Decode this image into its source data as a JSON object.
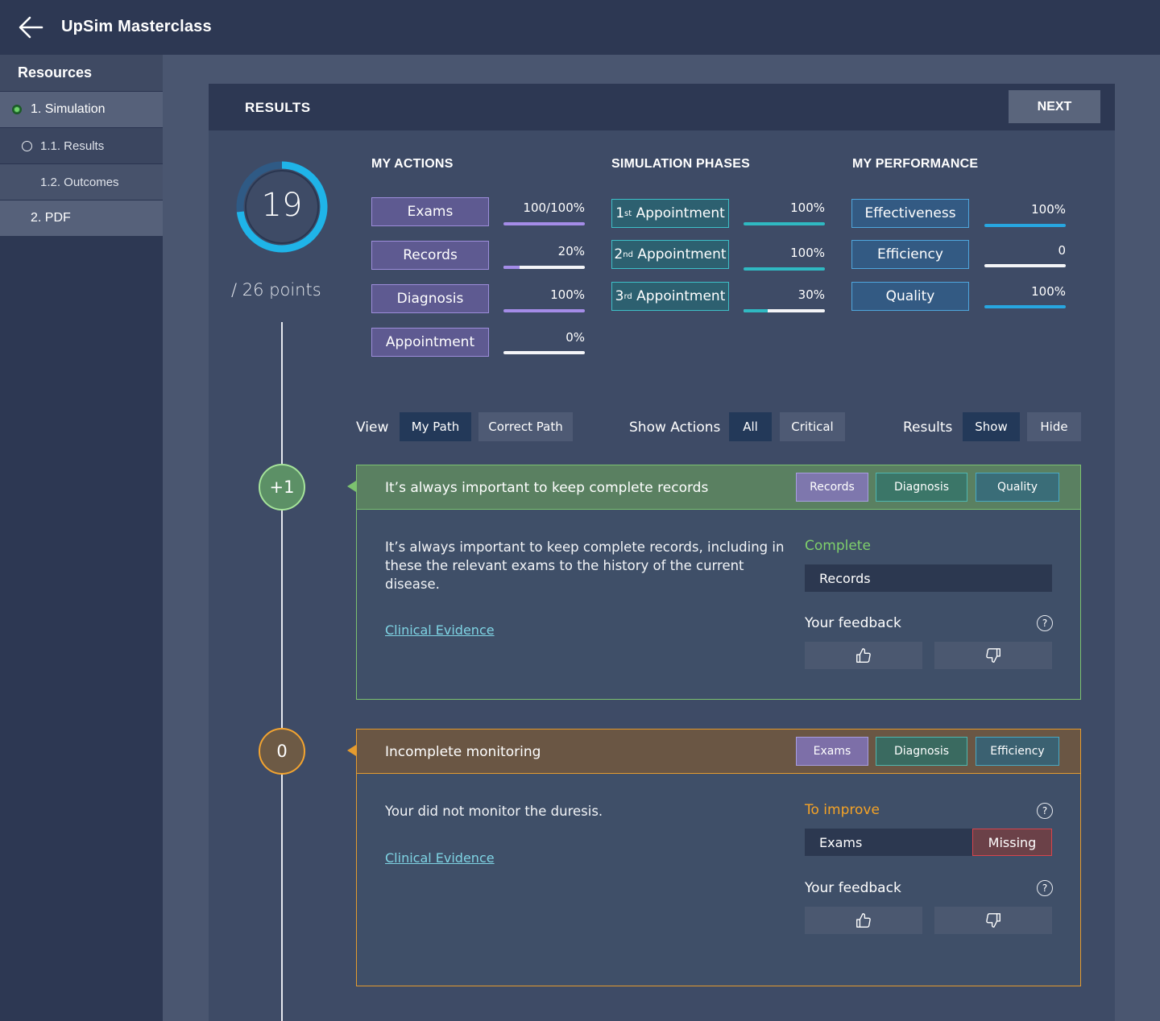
{
  "app": {
    "title": "UpSim Masterclass",
    "back_icon": "arrow-left-icon"
  },
  "sidebar": {
    "heading": "Resources",
    "items": [
      {
        "label": "1. Simulation",
        "state": "active"
      },
      {
        "label": "1.1. Results",
        "state": "current"
      },
      {
        "label": "1.2. Outcomes",
        "state": "default"
      },
      {
        "label": "2. PDF",
        "state": "default"
      }
    ]
  },
  "panel": {
    "title": "RESULTS",
    "next_label": "NEXT"
  },
  "score": {
    "value": "19",
    "total_label": "/ 26 points",
    "value_num": 19,
    "max": 26,
    "ring_color": "#1fb4e8"
  },
  "columns": {
    "actions_title": "MY ACTIONS",
    "phases_title": "SIMULATION PHASES",
    "performance_title": "MY PERFORMANCE"
  },
  "actions": [
    {
      "label": "Exams",
      "value": "100/100%",
      "fraction": 1.0
    },
    {
      "label": "Records",
      "value": "20%",
      "fraction": 0.2
    },
    {
      "label": "Diagnosis",
      "value": "100%",
      "fraction": 1.0
    },
    {
      "label": "Appointment",
      "value": "0%",
      "fraction": 0.0
    }
  ],
  "phases": [
    {
      "ordinal": "1",
      "suffix": "st",
      "label": "Appointment",
      "value": "100%",
      "fraction": 1.0
    },
    {
      "ordinal": "2",
      "suffix": "nd",
      "label": "Appointment",
      "value": "100%",
      "fraction": 1.0
    },
    {
      "ordinal": "3",
      "suffix": "rd",
      "label": "Appointment",
      "value": "30%",
      "fraction": 0.3
    }
  ],
  "performance": [
    {
      "label": "Effectiveness",
      "value": "100%",
      "fraction": 1.0
    },
    {
      "label": "Efficiency",
      "value": "0",
      "fraction": 0.0
    },
    {
      "label": "Quality",
      "value": "100%",
      "fraction": 1.0
    }
  ],
  "filters": {
    "view_label": "View",
    "my_path": "My Path",
    "correct_path": "Correct Path",
    "show_actions_label": "Show Actions",
    "all": "All",
    "critical": "Critical",
    "results_label": "Results",
    "show": "Show",
    "hide": "Hide"
  },
  "steps": [
    {
      "score": "+1",
      "title": "It’s always important to keep complete records",
      "tags": [
        "Records",
        "Diagnosis",
        "Quality"
      ],
      "body": "It’s always important to keep complete records, including in these the relevant exams to the history of the current disease.",
      "evidence_label": "Clinical Evidence",
      "status_label": "Complete",
      "status_color": "#7fd06b",
      "status_item": "Records",
      "feedback_label": "Your feedback",
      "help_glyph": "?"
    },
    {
      "score": "0",
      "title": "Incomplete monitoring",
      "tags": [
        "Exams",
        "Diagnosis",
        "Efficiency"
      ],
      "body": "Your did not monitor the duresis.",
      "evidence_label": "Clinical Evidence",
      "status_label": "To improve",
      "status_color": "#f5a326",
      "status_item": "Exams",
      "missing_label": "Missing",
      "feedback_label": "Your feedback",
      "help_glyph": "?"
    }
  ]
}
